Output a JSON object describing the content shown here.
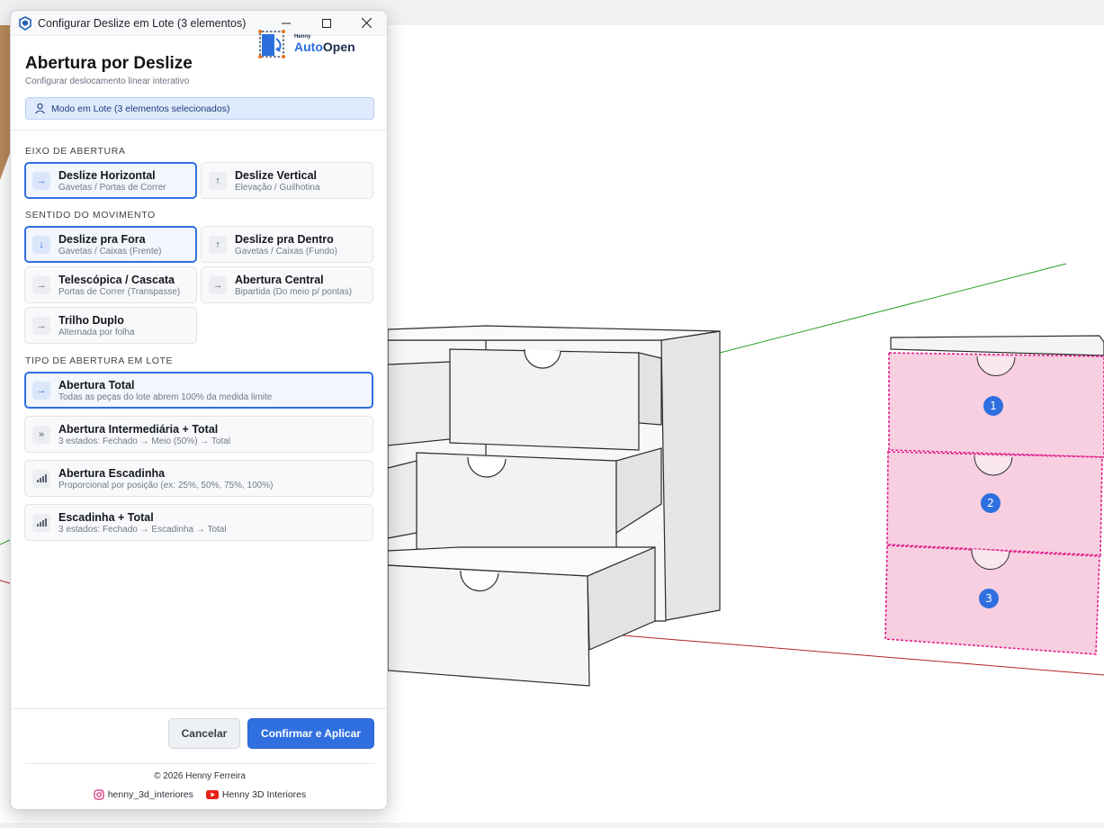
{
  "window": {
    "title": "Configurar Deslize em Lote (3 elementos)"
  },
  "header": {
    "title": "Abertura por Deslize",
    "subtitle": "Configurar deslocamento linear interativo",
    "logo_small": "Henny",
    "logo_auto": "Auto",
    "logo_open": "Open"
  },
  "mode": {
    "text": "Modo em Lote (3 elementos selecionados)"
  },
  "sections": {
    "axis": {
      "label": "EIXO DE ABERTURA",
      "options": [
        {
          "label": "Deslize Horizontal",
          "desc": "Gavetas / Portas de Correr",
          "icon": "→",
          "selected": true
        },
        {
          "label": "Deslize Vertical",
          "desc": "Elevação / Guilhotina",
          "icon": "↑",
          "selected": false
        }
      ]
    },
    "direction": {
      "label": "SENTIDO DO MOVIMENTO",
      "options": [
        {
          "label": "Deslize pra Fora",
          "desc": "Gavetas / Caixas (Frente)",
          "icon": "↓",
          "selected": true
        },
        {
          "label": "Deslize pra Dentro",
          "desc": "Gavetas / Caixas (Fundo)",
          "icon": "↑",
          "selected": false
        },
        {
          "label": "Telescópica / Cascata",
          "desc": "Portas de Correr (Transpasse)",
          "icon": "→",
          "selected": false
        },
        {
          "label": "Abertura Central",
          "desc": "Bipartida (Do meio p/ pontas)",
          "icon": "→",
          "selected": false
        },
        {
          "label": "Trilho Duplo",
          "desc": "Alternada por folha",
          "icon": "→",
          "selected": false
        }
      ]
    },
    "batch": {
      "label": "TIPO DE ABERTURA EM LOTE",
      "options": [
        {
          "label": "Abertura Total",
          "desc": "Todas as peças do lote abrem 100% da medida limite",
          "icon": "→",
          "selected": true
        },
        {
          "label": "Abertura Intermediária + Total",
          "desc": "3 estados: Fechado → Meio (50%) → Total",
          "icon": "»",
          "selected": false
        },
        {
          "label": "Abertura Escadinha",
          "desc": "Proporcional por posição (ex: 25%, 50%, 75%, 100%)",
          "icon": "bars",
          "selected": false
        },
        {
          "label": "Escadinha + Total",
          "desc": "3 estados: Fechado → Escadinha → Total",
          "icon": "bars",
          "selected": false
        }
      ]
    }
  },
  "buttons": {
    "cancel": "Cancelar",
    "confirm": "Confirmar e Aplicar"
  },
  "footer": {
    "copyright": "© 2026 Henny Ferreira",
    "instagram": "henny_3d_interiores",
    "youtube": "Henny 3D Interiores"
  },
  "viewport": {
    "badges": [
      "1",
      "2",
      "3"
    ]
  },
  "colors": {
    "accent": "#2f6fe0",
    "selection_pink": "#f7cfe1",
    "selection_border": "#e0208a"
  }
}
